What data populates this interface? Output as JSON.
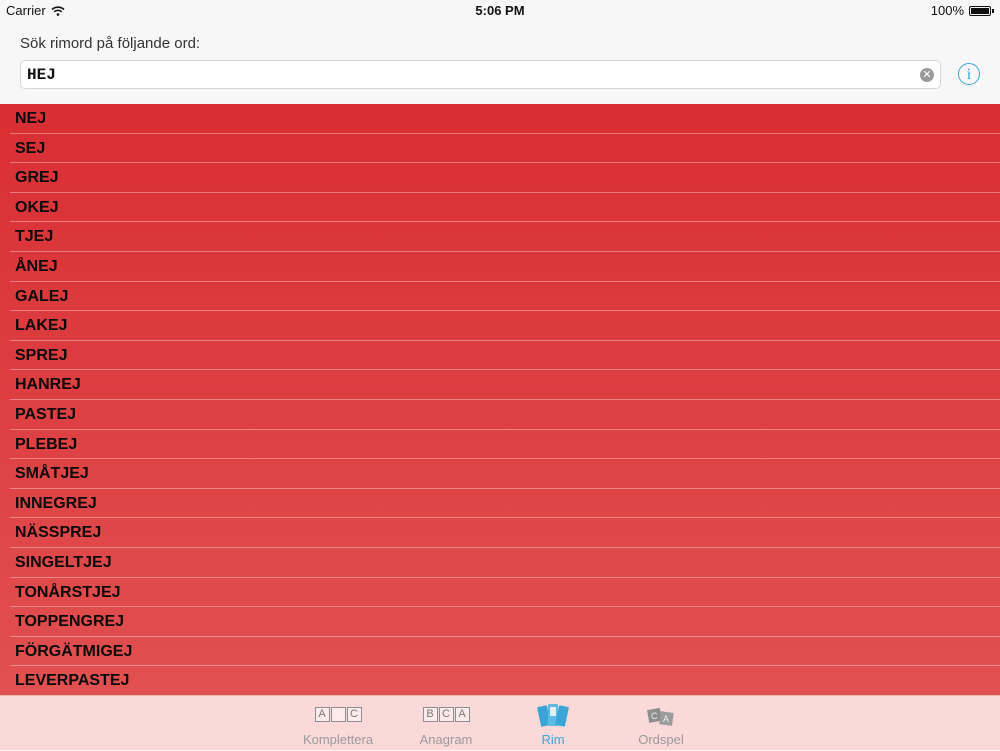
{
  "status": {
    "carrier": "Carrier",
    "time": "5:06 PM",
    "battery": "100%"
  },
  "header": {
    "prompt": "Sök rimord på följande ord:",
    "search_value": "HEJ",
    "clear_icon": "clear-icon",
    "info_icon": "info-icon"
  },
  "results": [
    {
      "word": "NEJ"
    },
    {
      "word": "SEJ"
    },
    {
      "word": "GREJ"
    },
    {
      "word": "OKEJ"
    },
    {
      "word": "TJEJ"
    },
    {
      "word": "ÅNEJ"
    },
    {
      "word": "GALEJ"
    },
    {
      "word": "LAKEJ"
    },
    {
      "word": "SPREJ"
    },
    {
      "word": "HANREJ"
    },
    {
      "word": "PASTEJ"
    },
    {
      "word": "PLEBEJ"
    },
    {
      "word": "SMÅTJEJ"
    },
    {
      "word": "INNEGREJ"
    },
    {
      "word": "NÄSSPREJ"
    },
    {
      "word": "SINGELTJEJ"
    },
    {
      "word": "TONÅRSTJEJ"
    },
    {
      "word": "TOPPENGREJ"
    },
    {
      "word": "FÖRGÄTMIGEJ"
    },
    {
      "word": "LEVERPASTEJ"
    }
  ],
  "tabs": [
    {
      "label": "Komplettera",
      "tiles": [
        "A",
        "",
        "C"
      ]
    },
    {
      "label": "Anagram",
      "tiles": [
        "B",
        "C",
        "A"
      ]
    },
    {
      "label": "Rim",
      "active": true
    },
    {
      "label": "Ordspel",
      "tiles": [
        "C",
        "A"
      ]
    }
  ],
  "colors": {
    "accent": "#3aa6d8",
    "list_top": "#d92e33",
    "list_bottom": "#e15050",
    "tabbar": "#fcd9d9"
  }
}
